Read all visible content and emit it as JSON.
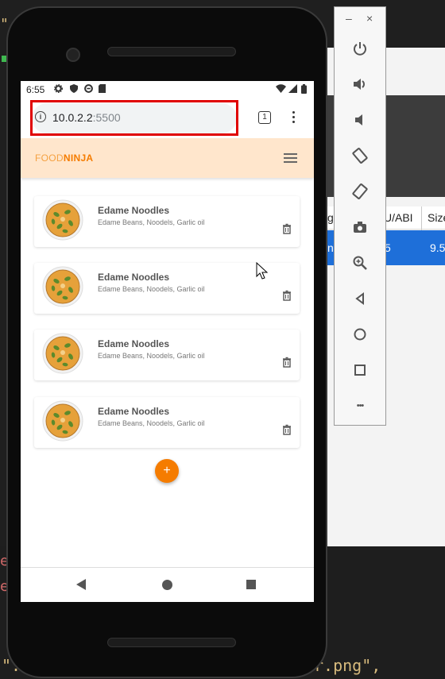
{
  "background": {
    "table_headers": [
      "g",
      "U/ABI",
      "Size"
    ],
    "table_row": [
      "nd",
      "5",
      "9.5"
    ],
    "code_fragment": "r.png\",",
    "code_quote": "\".",
    "code_top": "\"",
    "code_side_chars": [
      "e",
      "e"
    ]
  },
  "emulator_toolbar": {
    "minimize_label": "–",
    "close_label": "×",
    "more_label": "•••"
  },
  "status_bar": {
    "time": "6:55"
  },
  "browser": {
    "url_host": "10.0.2.2",
    "url_port": ":5500",
    "tab_count": "1"
  },
  "app": {
    "brand_part1": "FOOD",
    "brand_part2": "NINJA",
    "colors": {
      "navbar": "#ffe6cc",
      "accent": "#f57c00",
      "highlight": "#e00000"
    },
    "recipes": [
      {
        "title": "Edame Noodles",
        "ingredients": "Edame Beans, Noodels, Garlic oil"
      },
      {
        "title": "Edame Noodles",
        "ingredients": "Edame Beans, Noodels, Garlic oil"
      },
      {
        "title": "Edame Noodles",
        "ingredients": "Edame Beans, Noodels, Garlic oil"
      },
      {
        "title": "Edame Noodles",
        "ingredients": "Edame Beans, Noodels, Garlic oil"
      }
    ],
    "add_button_label": "+"
  }
}
